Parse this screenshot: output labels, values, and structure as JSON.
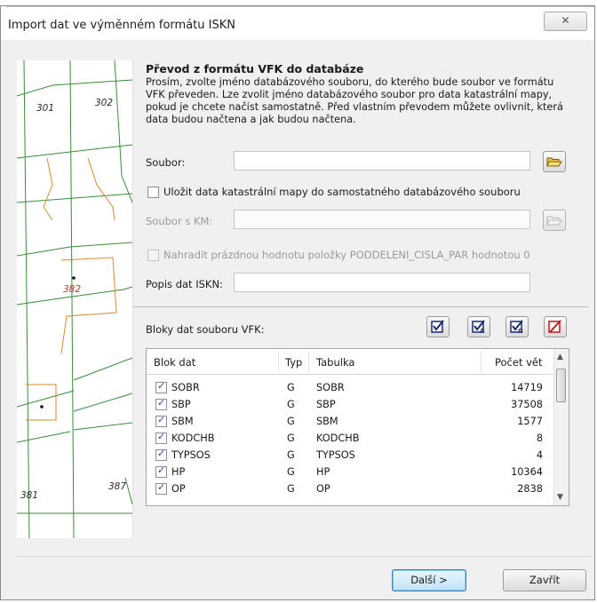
{
  "window": {
    "title": "Import dat ve výměnném formátu ISKN",
    "close_glyph": "⌧"
  },
  "map": {
    "labels": {
      "p301": "301",
      "p302": "302",
      "p382": "382",
      "p381": "381",
      "p387": "387"
    }
  },
  "intro": {
    "title": "Převod z formátu VFK do databáze",
    "description": "Prosím, zvolte jméno databázového souboru, do kterého bude soubor ve formátu VFK převeden. Lze zvolit jméno databázového soubor pro data katastrální mapy, pokud je chcete načíst samostatně. Před vlastním převodem můžete ovlivnit, která data budou načtena a jak budou načtena."
  },
  "form": {
    "soubor_label": "Soubor:",
    "soubor_value": "",
    "ulozit_label": "Uložit data katastrální mapy do samostatného databázového souboru",
    "ulozit_checked": false,
    "soubor_km_label": "Soubor s KM:",
    "soubor_km_value": "",
    "nahradit_label": "Nahradit prázdnou hodnotu položky PODDELENI_CISLA_PAR hodnotou 0",
    "nahradit_checked": false,
    "popis_label": "Popis dat ISKN:",
    "popis_value": ""
  },
  "blocks": {
    "label": "Bloky dat souboru VFK:",
    "columns": [
      "Blok dat",
      "Typ",
      "Tabulka",
      "Počet vět"
    ],
    "rows": [
      {
        "checked": true,
        "blok": "SOBR",
        "typ": "G",
        "tabulka": "SOBR",
        "pocet": "14719"
      },
      {
        "checked": true,
        "blok": "SBP",
        "typ": "G",
        "tabulka": "SBP",
        "pocet": "37508"
      },
      {
        "checked": true,
        "blok": "SBM",
        "typ": "G",
        "tabulka": "SBM",
        "pocet": "1577"
      },
      {
        "checked": true,
        "blok": "KODCHB",
        "typ": "G",
        "tabulka": "KODCHB",
        "pocet": "8"
      },
      {
        "checked": true,
        "blok": "TYPSOS",
        "typ": "G",
        "tabulka": "TYPSOS",
        "pocet": "4"
      },
      {
        "checked": true,
        "blok": "HP",
        "typ": "G",
        "tabulka": "HP",
        "pocet": "10364"
      },
      {
        "checked": true,
        "blok": "OP",
        "typ": "G",
        "tabulka": "OP",
        "pocet": "2838"
      }
    ]
  },
  "buttons": {
    "next": "Další >",
    "close": "Zavřít"
  }
}
